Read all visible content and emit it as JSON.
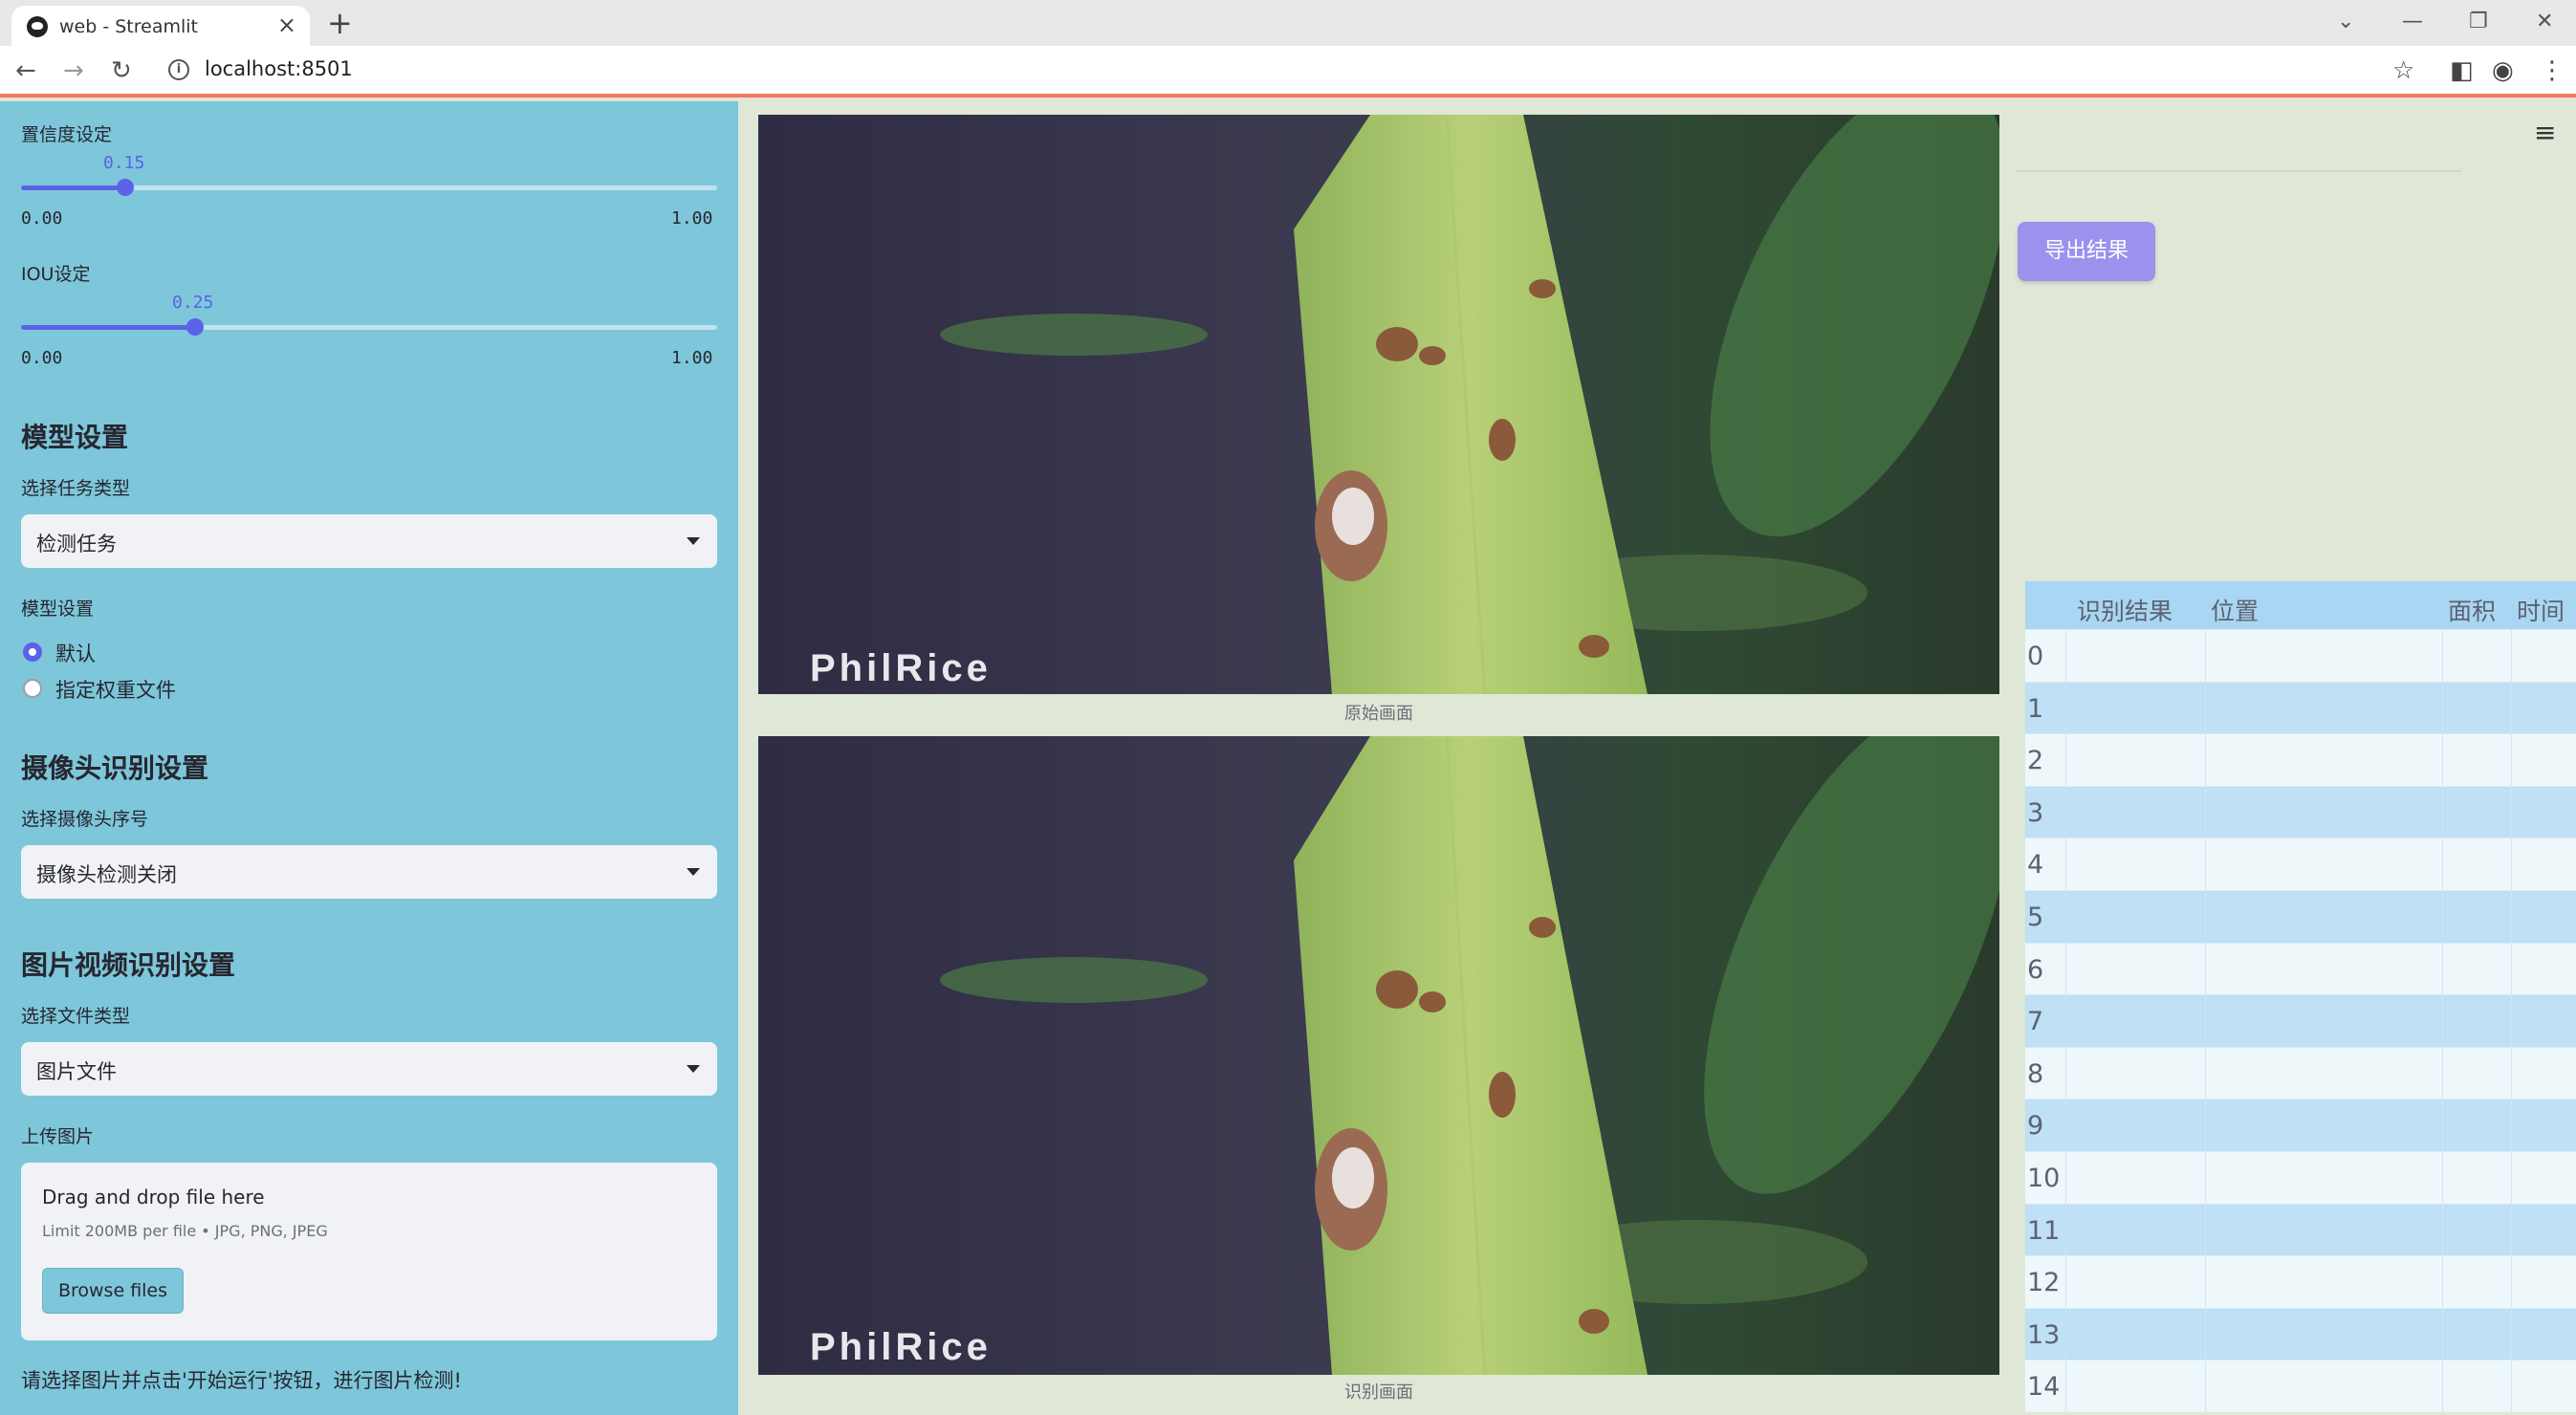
{
  "browser": {
    "tab_title": "web - Streamlit",
    "url": "localhost:8501"
  },
  "sidebar": {
    "confidence": {
      "label": "置信度设定",
      "value": "0.15",
      "min": "0.00",
      "max": "1.00",
      "fraction": 0.15
    },
    "iou": {
      "label": "IOU设定",
      "value": "0.25",
      "min": "0.00",
      "max": "1.00",
      "fraction": 0.25
    },
    "model_section": {
      "heading": "模型设置",
      "task_label": "选择任务类型",
      "task_value": "检测任务",
      "model_label": "模型设置",
      "options": [
        "默认",
        "指定权重文件"
      ],
      "selected_option": "默认"
    },
    "camera_section": {
      "heading": "摄像头识别设置",
      "camera_label": "选择摄像头序号",
      "camera_value": "摄像头检测关闭"
    },
    "media_section": {
      "heading": "图片视频识别设置",
      "file_type_label": "选择文件类型",
      "file_type_value": "图片文件",
      "upload_label": "上传图片",
      "drop_text": "Drag and drop file here",
      "limit_text": "Limit 200MB per file • JPG, PNG, JPEG",
      "browse_label": "Browse files"
    },
    "note": "请选择图片并点击'开始运行'按钮，进行图片检测!"
  },
  "main": {
    "original_caption": "原始画面",
    "result_caption": "识别画面",
    "watermark": "PhilRice"
  },
  "right_panel": {
    "export_label": "导出结果",
    "table": {
      "columns": [
        "识别结果",
        "位置",
        "面积",
        "时间"
      ],
      "row_indices": [
        "0",
        "1",
        "2",
        "3",
        "4",
        "5",
        "6",
        "7",
        "8",
        "9",
        "10",
        "11",
        "12",
        "13",
        "14"
      ]
    }
  }
}
